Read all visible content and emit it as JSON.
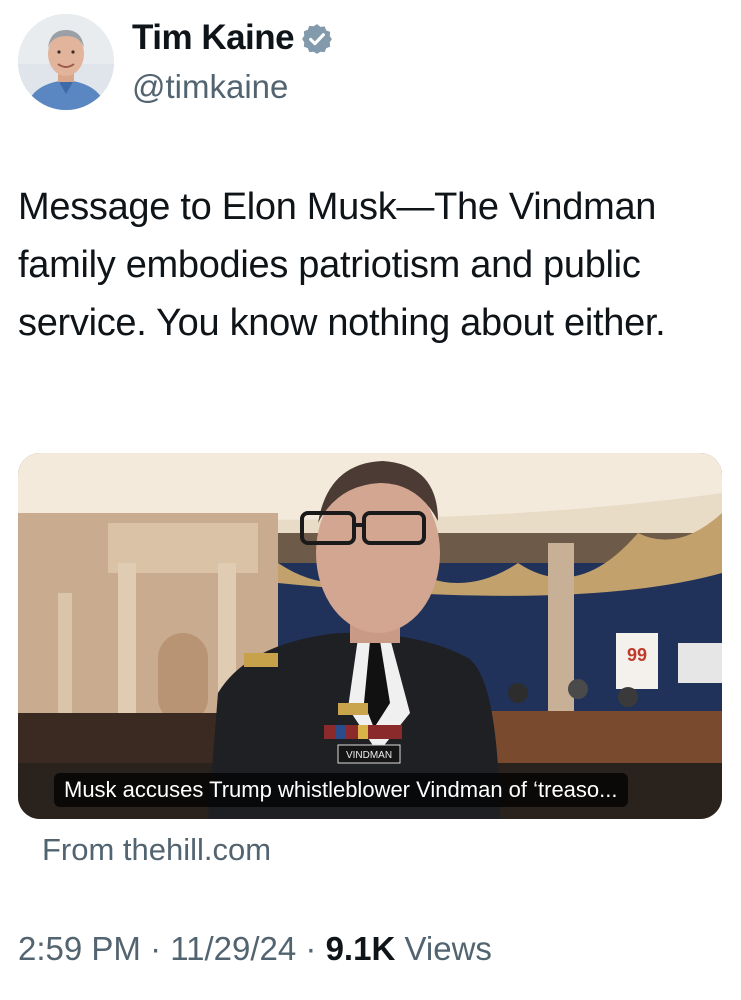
{
  "author": {
    "display_name": "Tim Kaine",
    "handle": "@timkaine",
    "verified": true,
    "avatar_icon": "profile-photo",
    "verified_icon": "verified-badge-icon"
  },
  "tweet": {
    "text": "Message to Elon Musk—The Vindman family embodies patriotism and public service.  You know nothing about either."
  },
  "link_card": {
    "caption": "Musk accuses Trump whistleblower Vindman of ‘treaso...",
    "source": "From thehill.com",
    "image_alt": "Man in army dress uniform with glasses in a hearing room",
    "nameplate_text": "VINDMAN",
    "sign_text": "99"
  },
  "meta": {
    "time": "2:59 PM",
    "sep1": " · ",
    "date": "11/29/24",
    "sep2": " · ",
    "views_count": "9.1K",
    "views_label": " Views"
  },
  "colors": {
    "text_primary": "#0f1419",
    "text_secondary": "#536471",
    "verified_blue": "#829aab"
  }
}
